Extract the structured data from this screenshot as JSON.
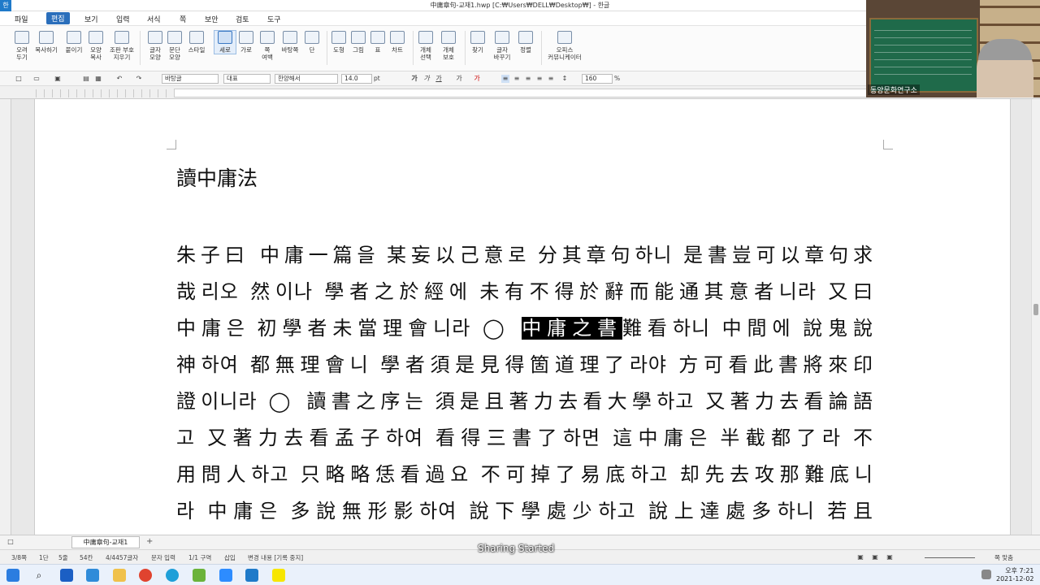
{
  "window": {
    "title": "中庸章句-교재1.hwp [C:₩Users₩DELL₩Desktop₩] - 한글",
    "app_icon": "한"
  },
  "menu": [
    "파일",
    "편집",
    "보기",
    "입력",
    "서식",
    "쪽",
    "보안",
    "검토",
    "도구"
  ],
  "ribbon": [
    {
      "label": "오려\n두기",
      "icon": "cut-icon"
    },
    {
      "label": "복사하기",
      "icon": "copy-icon"
    },
    {
      "label": "붙이기",
      "icon": "paste-icon"
    },
    {
      "label": "모양\n복사",
      "icon": "format-copy-icon"
    },
    {
      "label": "조판 부호\n지우기",
      "icon": "clear-code-icon"
    },
    {
      "label": "글자\n모양",
      "icon": "char-shape-icon"
    },
    {
      "label": "문단\n모양",
      "icon": "para-shape-icon"
    },
    {
      "label": "스타일",
      "icon": "style-icon"
    },
    {
      "label": "세로",
      "icon": "portrait-icon"
    },
    {
      "label": "가로",
      "icon": "landscape-icon"
    },
    {
      "label": "쪽\n여백",
      "icon": "margin-icon"
    },
    {
      "label": "바탕쪽",
      "icon": "master-page-icon"
    },
    {
      "label": "단",
      "icon": "columns-icon"
    },
    {
      "label": "도형",
      "icon": "shape-icon"
    },
    {
      "label": "그림",
      "icon": "picture-icon"
    },
    {
      "label": "표",
      "icon": "table-icon"
    },
    {
      "label": "차트",
      "icon": "chart-icon"
    },
    {
      "label": "개체\n선택",
      "icon": "select-object-icon"
    },
    {
      "label": "개체\n보호",
      "icon": "protect-object-icon"
    },
    {
      "label": "찾기",
      "icon": "find-icon"
    },
    {
      "label": "글자\n바꾸기",
      "icon": "replace-icon"
    },
    {
      "label": "정렬",
      "icon": "sort-icon"
    },
    {
      "label": "오피스\n커뮤니케이터",
      "icon": "communicator-icon"
    }
  ],
  "format": {
    "style": "바탕글",
    "font_lang": "대표",
    "font": "한양해서",
    "size": "14.0",
    "size_unit": "pt",
    "zoom": "160",
    "zoom_unit": "%"
  },
  "document": {
    "title": "讀中庸法",
    "lines": [
      "朱子曰 中庸一篇을 某妄以己意로 分其章句하니 是書豈可以章句求",
      "哉리오 然이나 學者之於經에 未有不得於辭而能通其意者니라 又曰",
      "中庸은 初學者未當理會니라 ◯ ",
      "神하여 都無理會니 學者須是見得箇道理了라야 方可看此書將來印",
      "證이니라 ◯ 讀書之序는 須是且著力去看大學하고 又著力去看論語",
      "고 又著力去看孟子하여 看得三書了하면 這中庸은 半截都了라 不",
      "用問人하고 只略略恁看過요 不可掉了易底하고 却先去攻那難底니",
      "라 中庸은 多說無形影하여 說下學處少하고 說上達處多하니 若且"
    ],
    "line3_highlight": "中庸之書",
    "line3_tail": "難看하니 中間에 說鬼說"
  },
  "tab": {
    "doc_tab": "中庸章句-교재1",
    "add": "+"
  },
  "status": {
    "page": "3/8쪽",
    "column": "1단",
    "line": "5줄",
    "char": "54칸",
    "count": "4/4457글자",
    "mode": "문자 입력",
    "section": "1/1 구역",
    "insert": "삽입",
    "track": "변경 내용 [기록 중지]",
    "fit": "쪽 맞춤"
  },
  "overlay": "Sharing Started",
  "tray": {
    "time": "오후 7:21",
    "date": "2021-12-02"
  },
  "video": {
    "name": "동양문화연구소"
  }
}
